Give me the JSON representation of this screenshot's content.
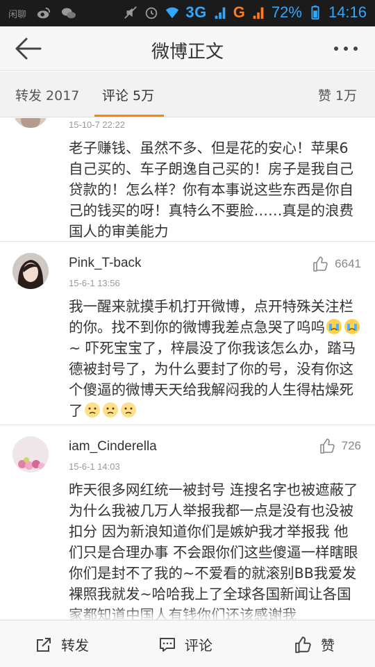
{
  "status_bar": {
    "left_text": "闲聊",
    "network": "3G",
    "network2": "G",
    "battery": "72%",
    "time": "14:16"
  },
  "header": {
    "title": "微博正文"
  },
  "tabs": {
    "repost": "转发 2017",
    "comment": "评论 5万",
    "like": "赞 1万"
  },
  "comments": [
    {
      "name": "",
      "time": "15-10-7 22:22",
      "likes": "",
      "text": "老子赚钱、虽然不多、但是花的安心！苹果6自己买的、车子朗逸自己买的！房子是我自己贷款的！怎么样？你有本事说这些东西是你自己的钱买的呀！真特么不要脸……真是的浪费国人的审美能力"
    },
    {
      "name": "Pink_T-back",
      "time": "15-6-1 13:56",
      "likes": "6641",
      "text_a": "我一醒来就摸手机打开微博，点开特殊关注栏的你。找不到你的微博我差点急哭了呜呜",
      "text_b": "~ 吓死宝宝了，梓晨没了你我该怎么办，踏马德被封号了，为什么要封了你的号，没有你这个傻逼的微博天天给我解闷我的人生得枯燥死了"
    },
    {
      "name": "iam_Cinderella",
      "time": "15-6-1 14:03",
      "likes": "726",
      "text": "昨天很多网红统一被封号 连搜名字也被遮蔽了 为什么我被几万人举报我都一点是没有也没被扣分 因为新浪知道你们是嫉妒我才举报我 他们只是合理办事 不会跟你们这些傻逼一样瞎眼 你们是封不了我的~不爱看的就滚别BB我爱发裸照我就发~哈哈我上了全球各国新闻让各国家都知道中国人有钱你们还该感谢我"
    }
  ],
  "bottom_bar": {
    "repost": "转发",
    "comment": "评论",
    "like": "赞"
  },
  "colors": {
    "accent": "#ff8200",
    "statusbar_text": "#31a8ff"
  }
}
